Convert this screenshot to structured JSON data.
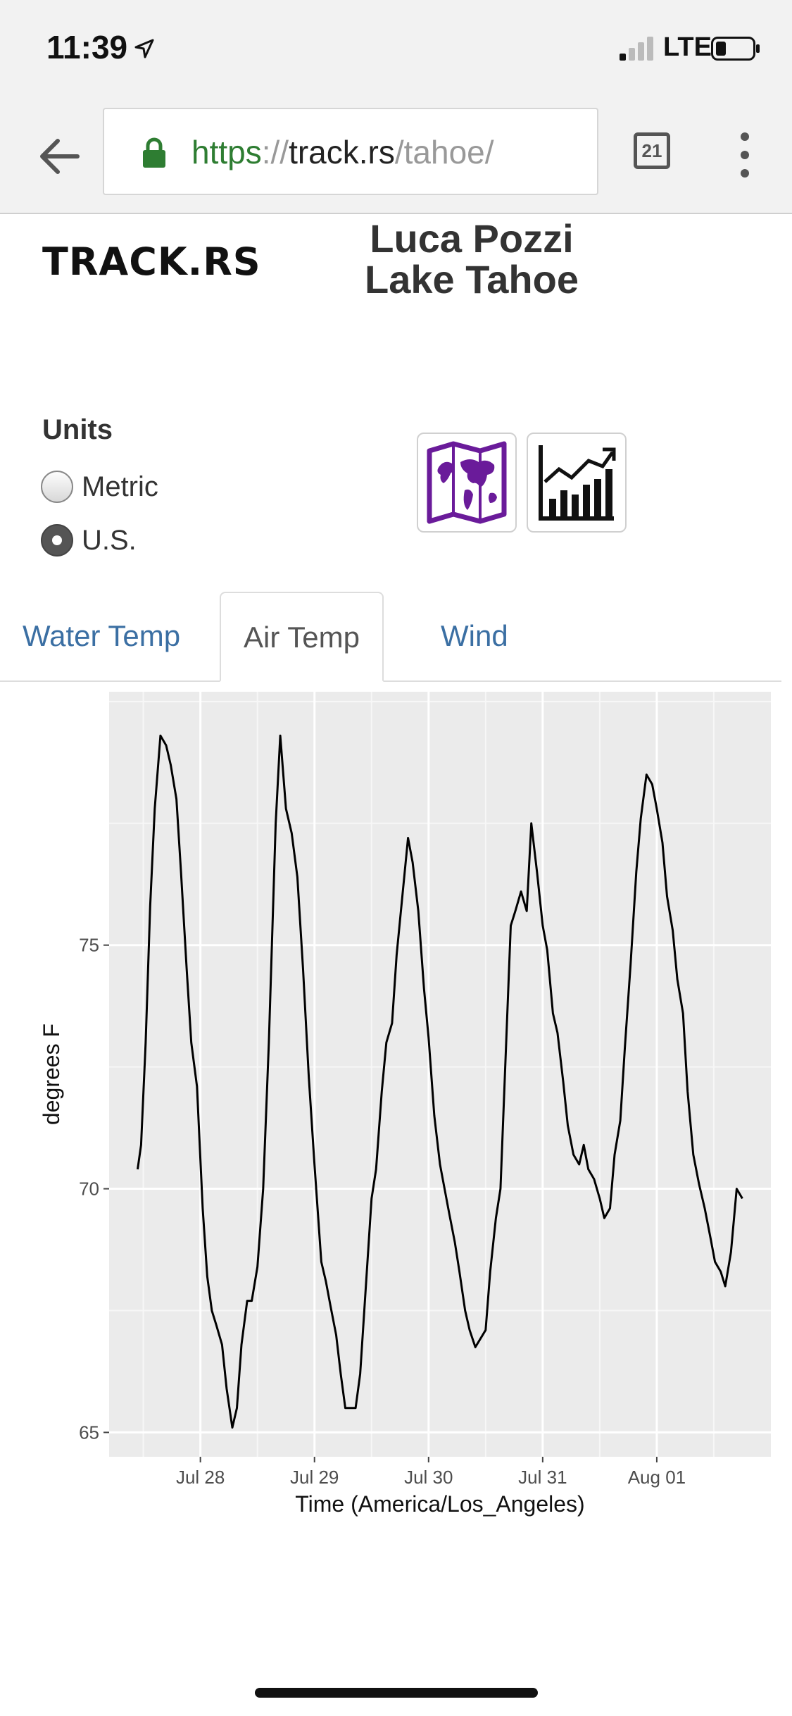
{
  "status_bar": {
    "time": "11:39",
    "network": "LTE"
  },
  "browser": {
    "url_scheme": "https",
    "url_sep": "://",
    "url_host": "track.rs",
    "url_path": "/tahoe/",
    "tab_count": "21"
  },
  "page": {
    "logo": "TRACK.RS",
    "title_line1": "Luca Pozzi",
    "title_line2": "Lake Tahoe",
    "units_label": "Units",
    "units_options": [
      "Metric",
      "U.S."
    ],
    "units_selected": "U.S.",
    "tabs": [
      "Water Temp",
      "Air Temp",
      "Wind"
    ],
    "active_tab": "Air Temp"
  },
  "chart_data": {
    "type": "line",
    "xlabel": "Time (America/Los_Angeles)",
    "ylabel": "degrees F",
    "x_ticks": [
      "Jul 28",
      "Jul 29",
      "Jul 30",
      "Jul 31",
      "Aug 01"
    ],
    "y_ticks": [
      65,
      70,
      75
    ],
    "ylim": [
      64.5,
      80.2
    ],
    "xlim_days": [
      27.2,
      33.0
    ],
    "grid": true,
    "series": [
      {
        "values": [
          [
            27.45,
            70.4
          ],
          [
            27.48,
            70.9
          ],
          [
            27.52,
            73.0
          ],
          [
            27.56,
            75.8
          ],
          [
            27.6,
            77.8
          ],
          [
            27.65,
            79.3
          ],
          [
            27.7,
            79.1
          ],
          [
            27.74,
            78.7
          ],
          [
            27.79,
            78.0
          ],
          [
            27.83,
            76.5
          ],
          [
            27.88,
            74.5
          ],
          [
            27.92,
            73.0
          ],
          [
            27.97,
            72.1
          ],
          [
            28.02,
            69.6
          ],
          [
            28.06,
            68.2
          ],
          [
            28.1,
            67.5
          ],
          [
            28.14,
            67.2
          ],
          [
            28.19,
            66.8
          ],
          [
            28.23,
            65.9
          ],
          [
            28.28,
            65.1
          ],
          [
            28.32,
            65.5
          ],
          [
            28.36,
            66.8
          ],
          [
            28.41,
            67.7
          ],
          [
            28.45,
            67.7
          ],
          [
            28.5,
            68.4
          ],
          [
            28.55,
            70.0
          ],
          [
            28.6,
            73.0
          ],
          [
            28.66,
            77.5
          ],
          [
            28.7,
            79.3
          ],
          [
            28.75,
            77.8
          ],
          [
            28.8,
            77.3
          ],
          [
            28.85,
            76.4
          ],
          [
            28.9,
            74.5
          ],
          [
            28.95,
            72.3
          ],
          [
            29.0,
            70.5
          ],
          [
            29.06,
            68.5
          ],
          [
            29.1,
            68.1
          ],
          [
            29.14,
            67.6
          ],
          [
            29.19,
            67.0
          ],
          [
            29.23,
            66.2
          ],
          [
            29.27,
            65.5
          ],
          [
            29.36,
            65.5
          ],
          [
            29.4,
            66.2
          ],
          [
            29.45,
            68.0
          ],
          [
            29.5,
            69.8
          ],
          [
            29.54,
            70.4
          ],
          [
            29.59,
            72.0
          ],
          [
            29.63,
            73.0
          ],
          [
            29.68,
            73.4
          ],
          [
            29.72,
            74.8
          ],
          [
            29.77,
            76.0
          ],
          [
            29.82,
            77.2
          ],
          [
            29.86,
            76.7
          ],
          [
            29.91,
            75.7
          ],
          [
            29.96,
            74.1
          ],
          [
            30.0,
            73.1
          ],
          [
            30.05,
            71.5
          ],
          [
            30.1,
            70.5
          ],
          [
            30.14,
            70.0
          ],
          [
            30.18,
            69.5
          ],
          [
            30.23,
            68.9
          ],
          [
            30.27,
            68.3
          ],
          [
            30.32,
            67.5
          ],
          [
            30.36,
            67.1
          ],
          [
            30.41,
            66.75
          ],
          [
            30.5,
            67.1
          ],
          [
            30.54,
            68.3
          ],
          [
            30.59,
            69.4
          ],
          [
            30.63,
            70.0
          ],
          [
            30.68,
            73.0
          ],
          [
            30.72,
            75.4
          ],
          [
            30.76,
            75.7
          ],
          [
            30.81,
            76.1
          ],
          [
            30.86,
            75.7
          ],
          [
            30.9,
            77.5
          ],
          [
            30.95,
            76.5
          ],
          [
            31.0,
            75.4
          ],
          [
            31.04,
            74.9
          ],
          [
            31.09,
            73.6
          ],
          [
            31.13,
            73.2
          ],
          [
            31.18,
            72.2
          ],
          [
            31.22,
            71.3
          ],
          [
            31.27,
            70.7
          ],
          [
            31.32,
            70.5
          ],
          [
            31.36,
            70.9
          ],
          [
            31.4,
            70.4
          ],
          [
            31.45,
            70.2
          ],
          [
            31.5,
            69.8
          ],
          [
            31.54,
            69.4
          ],
          [
            31.59,
            69.6
          ],
          [
            31.63,
            70.7
          ],
          [
            31.68,
            71.4
          ],
          [
            31.72,
            72.9
          ],
          [
            31.77,
            74.6
          ],
          [
            31.82,
            76.5
          ],
          [
            31.86,
            77.6
          ],
          [
            31.91,
            78.5
          ],
          [
            31.96,
            78.3
          ],
          [
            32.0,
            77.8
          ],
          [
            32.05,
            77.1
          ],
          [
            32.09,
            76.0
          ],
          [
            32.14,
            75.3
          ],
          [
            32.18,
            74.3
          ],
          [
            32.23,
            73.6
          ],
          [
            32.27,
            72.0
          ],
          [
            32.32,
            70.7
          ],
          [
            32.37,
            70.1
          ],
          [
            32.42,
            69.6
          ],
          [
            32.47,
            69.0
          ],
          [
            32.51,
            68.5
          ],
          [
            32.56,
            68.3
          ],
          [
            32.6,
            68.0
          ],
          [
            32.65,
            68.7
          ],
          [
            32.7,
            70.0
          ],
          [
            32.75,
            69.8
          ]
        ]
      }
    ]
  }
}
